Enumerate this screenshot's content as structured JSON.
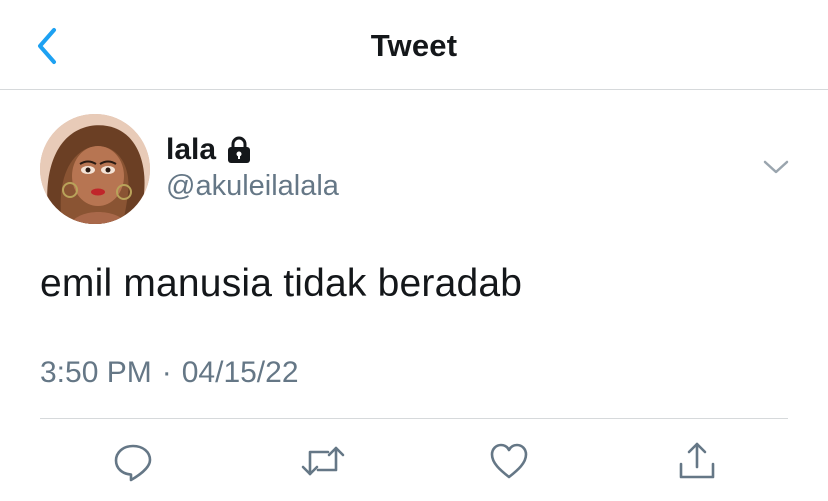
{
  "header": {
    "title": "Tweet"
  },
  "author": {
    "display_name": "lala",
    "handle": "@akuleilalala",
    "protected_icon": "lock-icon",
    "avatar_icon": "avatar"
  },
  "tweet": {
    "text": "emil manusia tidak beradab",
    "time": "3:50 PM",
    "separator": "·",
    "date": "04/15/22"
  },
  "actions": {
    "reply_icon": "reply-icon",
    "retweet_icon": "retweet-icon",
    "like_icon": "like-icon",
    "share_icon": "share-icon"
  },
  "colors": {
    "accent": "#1da1f2",
    "text_primary": "#14171a",
    "text_secondary": "#657786",
    "divider": "#d6d9db"
  }
}
